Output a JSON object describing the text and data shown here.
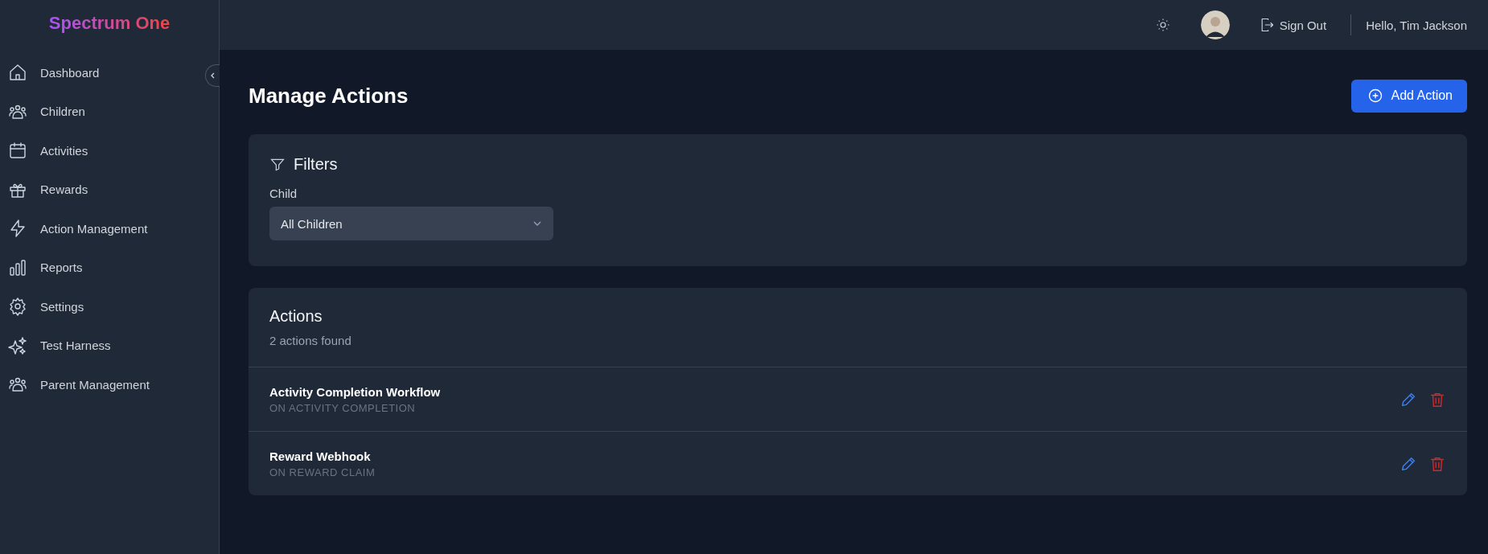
{
  "sidebar": {
    "brand": "Spectrum One",
    "items": [
      {
        "label": "Dashboard"
      },
      {
        "label": "Children"
      },
      {
        "label": "Activities"
      },
      {
        "label": "Rewards"
      },
      {
        "label": "Action Management"
      },
      {
        "label": "Reports"
      },
      {
        "label": "Settings"
      },
      {
        "label": "Test Harness"
      },
      {
        "label": "Parent Management"
      }
    ]
  },
  "header": {
    "sign_out": "Sign Out",
    "greeting": "Hello, Tim Jackson"
  },
  "page": {
    "title": "Manage Actions",
    "add_button": "Add Action"
  },
  "filters": {
    "title": "Filters",
    "field_label": "Child",
    "select_value": "All Children"
  },
  "actions": {
    "title": "Actions",
    "count": "2 actions found",
    "rows": [
      {
        "name": "Activity Completion Workflow",
        "trigger": "ON ACTIVITY COMPLETION"
      },
      {
        "name": "Reward Webhook",
        "trigger": "ON REWARD CLAIM"
      }
    ]
  }
}
